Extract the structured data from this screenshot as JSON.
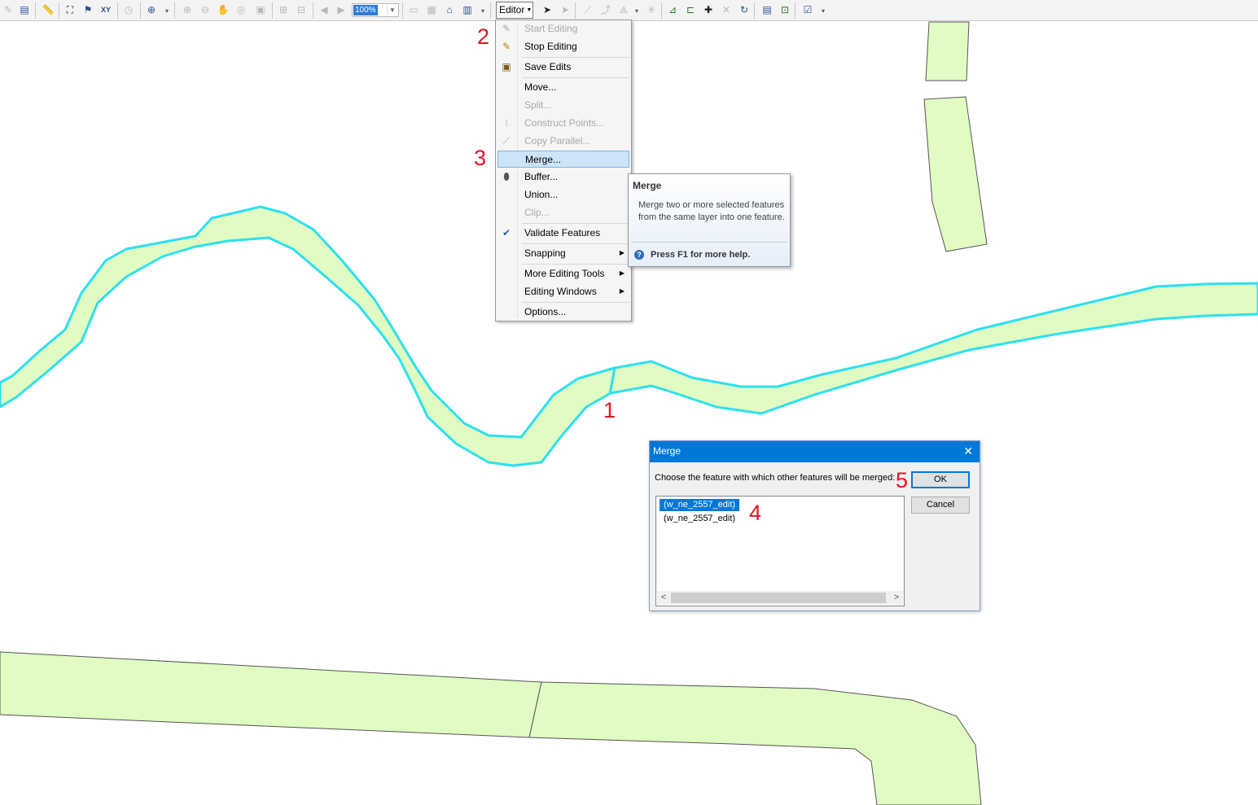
{
  "toolbar": {
    "zoom_value": "100%",
    "editor_label": "Editor"
  },
  "editor_menu": {
    "items": [
      {
        "label": "Start Editing",
        "enabled": false
      },
      {
        "label": "Stop Editing",
        "enabled": true
      },
      {
        "label": "Save Edits",
        "enabled": true
      },
      {
        "label": "Move...",
        "enabled": true
      },
      {
        "label": "Split...",
        "enabled": false
      },
      {
        "label": "Construct Points...",
        "enabled": false
      },
      {
        "label": "Copy Parallel...",
        "enabled": false
      },
      {
        "label": "Merge...",
        "enabled": true,
        "highlighted": true
      },
      {
        "label": "Buffer...",
        "enabled": true
      },
      {
        "label": "Union...",
        "enabled": true
      },
      {
        "label": "Clip...",
        "enabled": false
      },
      {
        "label": "Validate Features",
        "enabled": true
      },
      {
        "label": "Snapping",
        "enabled": true,
        "submenu": true
      },
      {
        "label": "More Editing Tools",
        "enabled": true,
        "submenu": true
      },
      {
        "label": "Editing Windows",
        "enabled": true,
        "submenu": true
      },
      {
        "label": "Options...",
        "enabled": true
      }
    ]
  },
  "tooltip": {
    "title": "Merge",
    "description": "Merge two or more selected features from the same layer into one feature.",
    "help": "Press F1 for more help."
  },
  "dialog": {
    "title": "Merge",
    "prompt": "Choose the feature with which other features will be merged:",
    "ok_label": "OK",
    "cancel_label": "Cancel",
    "features": [
      "(w_ne_2557_edit)",
      "(w_ne_2557_edit)"
    ],
    "selected_index": 0
  },
  "steps": [
    "1",
    "2",
    "3",
    "4",
    "5"
  ],
  "colors": {
    "feature_fill": "#e0fcc2",
    "selection_outline": "#2de0f0",
    "highlight": "#cce4f7",
    "dialog_title": "#0078d7",
    "step_annotation": "#e81123"
  }
}
